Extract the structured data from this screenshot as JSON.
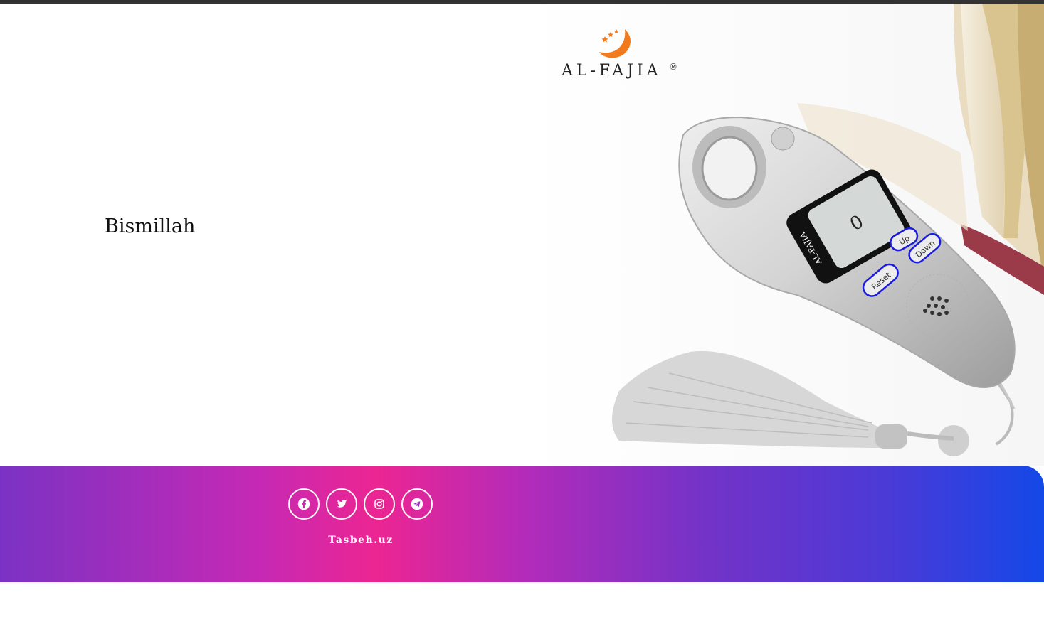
{
  "hero": {
    "heading": "Bismillah"
  },
  "product": {
    "brand_name": "AL-FAJIA",
    "registered_mark": "®",
    "device_brand": "AL-FAJIA",
    "counter_value": "0",
    "buttons": {
      "up": "Up",
      "down": "Down",
      "reset": "Reset"
    }
  },
  "footer": {
    "social": [
      {
        "name": "facebook",
        "icon": "facebook-icon"
      },
      {
        "name": "twitter",
        "icon": "twitter-icon"
      },
      {
        "name": "instagram",
        "icon": "instagram-icon"
      },
      {
        "name": "telegram",
        "icon": "telegram-icon"
      }
    ],
    "site_name": "Tasbeh.uz"
  },
  "colors": {
    "top_bar": "#333333",
    "gradient_start": "#7b32c4",
    "gradient_pink": "#ec2592",
    "gradient_end": "#1448e8",
    "brand_orange": "#f07a1c",
    "device_button_accent": "#1a1ae0"
  }
}
